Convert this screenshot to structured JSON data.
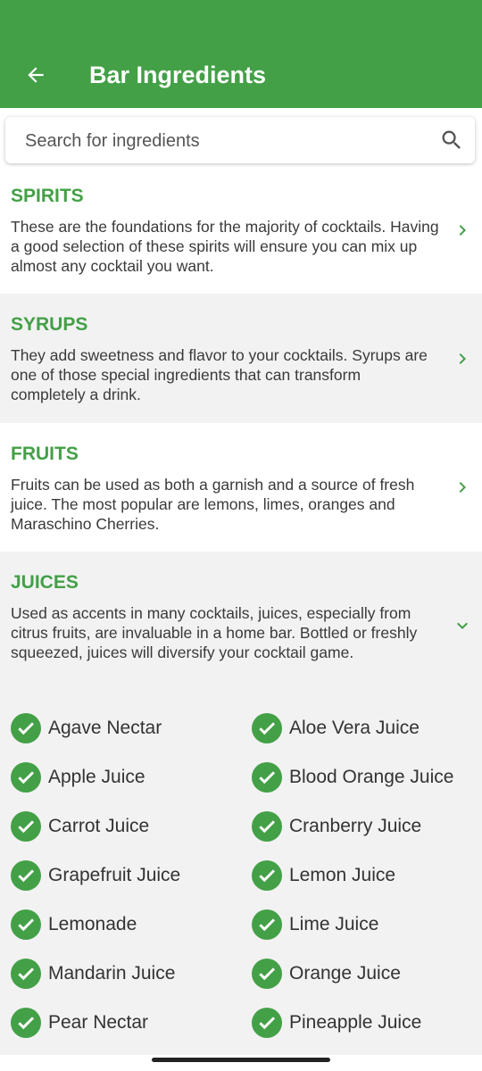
{
  "appbar": {
    "title": "Bar Ingredients",
    "back_icon": "arrow-left-icon",
    "color": "#43a047"
  },
  "search": {
    "placeholder": "Search for ingredients",
    "icon": "search-icon"
  },
  "sections": [
    {
      "title": "SPIRITS",
      "description": "These are the foundations for the majority of cocktails. Having a good selection of these spirits will ensure you can mix up almost any cocktail you want.",
      "icon": "chevron-right-icon"
    },
    {
      "title": "SYRUPS",
      "description": "They add sweetness and flavor to your cocktails. Syrups are one of those special ingredients that can transform completely a drink.",
      "icon": "chevron-right-icon"
    },
    {
      "title": "FRUITS",
      "description": "Fruits can be used as both a garnish and a source of fresh juice. The most popular are lemons, limes, oranges and Maraschino Cherries.",
      "icon": "chevron-right-icon"
    },
    {
      "title": "JUICES",
      "description": "Used as accents in many cocktails, juices, especially from citrus fruits, are invaluable in a home bar. Bottled or freshly squeezed, juices will diversify your cocktail game.",
      "icon": "chevron-down-icon",
      "expanded": true
    }
  ],
  "juices": [
    "Agave Nectar",
    "Aloe Vera Juice",
    "Apple Juice",
    "Blood Orange Juice",
    "Carrot Juice",
    "Cranberry Juice",
    "Grapefruit Juice",
    "Lemon Juice",
    "Lemonade",
    "Lime Juice",
    "Mandarin Juice",
    "Orange Juice",
    "Pear Nectar",
    "Pineapple Juice"
  ],
  "check_icon": "check-circle-icon",
  "accent_color": "#43a047"
}
